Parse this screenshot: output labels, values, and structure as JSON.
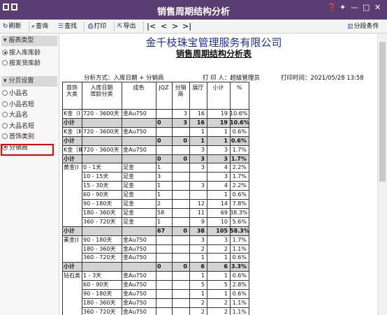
{
  "window": {
    "title": "销售周期结构分析"
  },
  "toolbar": {
    "refresh": "刷新",
    "query": "查询",
    "find": "查找",
    "print": "打印",
    "export": "导出",
    "pagination": "分段条件"
  },
  "icons": {
    "refresh": "refresh-icon",
    "search": "search-icon",
    "find": "find-icon",
    "print": "print-icon",
    "export": "export-icon",
    "first": "first-page-icon",
    "prev": "prev-page-icon",
    "next": "next-page-icon",
    "last": "last-page-icon",
    "pagination": "pagination-icon"
  },
  "sidebar": {
    "report_type_label": "报表类型",
    "report_types": [
      {
        "label": "按入库库龄",
        "selected": true
      },
      {
        "label": "按发货库龄",
        "selected": false
      }
    ],
    "paging_label": "分页设置",
    "paging_options": [
      {
        "label": "小品名",
        "selected": false
      },
      {
        "label": "小品名短",
        "selected": false
      },
      {
        "label": "大品名",
        "selected": false
      },
      {
        "label": "大品名短",
        "selected": false
      },
      {
        "label": "首饰类别",
        "selected": false
      },
      {
        "label": "分销商",
        "selected": true
      }
    ]
  },
  "report": {
    "company": "金千枝珠宝管理服务有限公司",
    "title": "销售周期结构分析表",
    "method": "分析方式：入库日期 + 分销商",
    "printer_label": "打 印 人：",
    "printer": "超级管理员",
    "print_time_label": "打印时间：",
    "print_time": "2021/05/28 13:58",
    "headers": [
      "首饰\n大类",
      "入库日期\n库龄分类",
      "成色",
      "JQZ",
      "分销\n商",
      "展厅",
      "小计",
      "%"
    ],
    "rows": [
      {
        "kind": "data",
        "c": [
          "K金（Ⅰ",
          "720 - 3600天",
          "金Au750",
          "",
          "3",
          "16",
          "19",
          "10.6%"
        ]
      },
      {
        "kind": "sub",
        "c": [
          "小计",
          "",
          "",
          "0",
          "3",
          "16",
          "19",
          "10.6%"
        ]
      },
      {
        "kind": "data",
        "c": [
          "K金（Ⅱ",
          "720 - 3600天",
          "金Au750",
          "",
          "",
          "1",
          "1",
          "0.6%"
        ]
      },
      {
        "kind": "sub",
        "c": [
          "小计",
          "",
          "",
          "0",
          "0",
          "1",
          "1",
          "0.6%"
        ]
      },
      {
        "kind": "data",
        "c": [
          "K金（Ⅲ",
          "720 - 3600天",
          "金Au750",
          "",
          "",
          "3",
          "3",
          "1.7%"
        ]
      },
      {
        "kind": "sub",
        "c": [
          "小计",
          "",
          "",
          "0",
          "0",
          "3",
          "3",
          "1.7%"
        ]
      },
      {
        "kind": "data",
        "c": [
          "黄金(Ⅰ",
          "0 - 1天",
          "足金",
          "1",
          "",
          "3",
          "4",
          "2.2%"
        ]
      },
      {
        "kind": "data",
        "c": [
          "",
          "10 - 15天",
          "足金",
          "3",
          "",
          "",
          "3",
          "1.7%"
        ]
      },
      {
        "kind": "data",
        "c": [
          "",
          "15 - 30天",
          "足金",
          "1",
          "",
          "3",
          "4",
          "2.2%"
        ]
      },
      {
        "kind": "data",
        "c": [
          "",
          "60 - 90天",
          "足金",
          "1",
          "",
          "",
          "1",
          "0.6%"
        ]
      },
      {
        "kind": "data",
        "c": [
          "",
          "90 - 180天",
          "足金",
          "2",
          "",
          "12",
          "14",
          "7.8%"
        ]
      },
      {
        "kind": "data",
        "c": [
          "",
          "180 - 360天",
          "足金",
          "58",
          "",
          "11",
          "69",
          "38.3%"
        ]
      },
      {
        "kind": "data",
        "c": [
          "",
          "360 - 720天",
          "足金",
          "1",
          "",
          "9",
          "10",
          "5.6%"
        ]
      },
      {
        "kind": "sub",
        "c": [
          "小计",
          "",
          "",
          "67",
          "0",
          "38",
          "105",
          "58.3%"
        ]
      },
      {
        "kind": "data",
        "c": [
          "素金(Ⅰ",
          "90 - 180天",
          "金Au750",
          "",
          "",
          "3",
          "3",
          "1.7%"
        ]
      },
      {
        "kind": "data",
        "c": [
          "",
          "180 - 360天",
          "金Au750",
          "",
          "",
          "2",
          "2",
          "1.1%"
        ]
      },
      {
        "kind": "data",
        "c": [
          "",
          "360 - 720天",
          "金Au750",
          "",
          "",
          "1",
          "1",
          "0.6%"
        ]
      },
      {
        "kind": "sub",
        "c": [
          "小计",
          "",
          "",
          "0",
          "0",
          "6",
          "6",
          "3.3%"
        ]
      },
      {
        "kind": "data",
        "c": [
          "钻石类",
          "1 - 3天",
          "金Au750",
          "",
          "",
          "1",
          "1",
          "0.6%"
        ]
      },
      {
        "kind": "data",
        "c": [
          "",
          "60 - 90天",
          "金Au750",
          "",
          "",
          "5",
          "5",
          "2.8%"
        ]
      },
      {
        "kind": "data",
        "c": [
          "",
          "90 - 180天",
          "金Au750",
          "",
          "",
          "1",
          "1",
          "0.6%"
        ]
      },
      {
        "kind": "data",
        "c": [
          "",
          "180 - 360天",
          "金Au750",
          "",
          "",
          "2",
          "2",
          "1.1%"
        ]
      },
      {
        "kind": "data",
        "c": [
          "",
          "360 - 720天",
          "金Au750",
          "",
          "",
          "2",
          "2",
          "1.1%"
        ]
      }
    ]
  },
  "colors": {
    "titlebar": "#5a3d73",
    "company": "#1d2fa5",
    "subtotal_bg": "#d3d3d3",
    "selection_border": "#e00000"
  }
}
